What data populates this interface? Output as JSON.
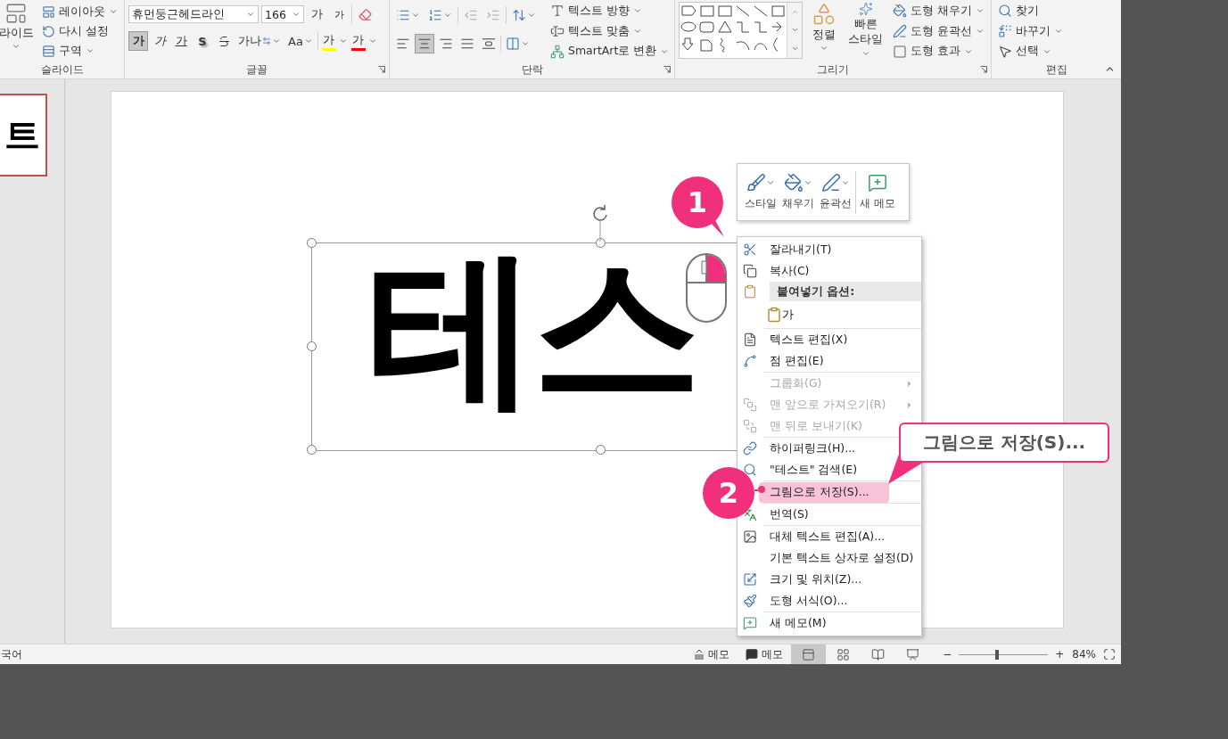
{
  "ribbon": {
    "slides": {
      "big_button": {
        "label": "라이드",
        "dropdown": true
      },
      "buttons": [
        {
          "label": "레이아웃",
          "dropdown": true
        },
        {
          "label": "다시 설정",
          "dropdown": false
        },
        {
          "label": "구역",
          "dropdown": true
        }
      ],
      "label": "슬라이드"
    },
    "font": {
      "font_name": "휴먼둥근헤드라인",
      "font_size": "166",
      "size_buttons": [
        {
          "label": "가"
        },
        {
          "label": "가"
        }
      ],
      "format_buttons": [
        {
          "kind": "bold",
          "label": "가",
          "selected": true
        },
        {
          "kind": "italic",
          "label": "가",
          "selected": false
        },
        {
          "kind": "underline",
          "label": "가",
          "selected": false
        },
        {
          "kind": "shadow",
          "label": "S",
          "selected": false
        },
        {
          "kind": "strike",
          "selected": false
        },
        {
          "kind": "spacing",
          "label": "가나",
          "selected": false
        },
        {
          "kind": "case",
          "label": "Aa",
          "selected": false
        }
      ],
      "color_buttons": [
        {
          "label": "가",
          "color": "#ffff00"
        },
        {
          "label": "가",
          "color": "#ff0000"
        }
      ],
      "label": "글꼴"
    },
    "paragraph": {
      "align_buttons": [
        {
          "selected": false
        },
        {
          "selected": true
        },
        {
          "selected": false
        },
        {
          "selected": false
        },
        {
          "selected": false
        }
      ],
      "text_buttons": [
        {
          "label": "텍스트 방향",
          "dropdown": true
        },
        {
          "label": "텍스트 맞춤",
          "dropdown": true
        },
        {
          "label": "SmartArt로 변환",
          "dropdown": true
        }
      ],
      "label": "단락"
    },
    "drawing": {
      "big_buttons": [
        {
          "label": "정렬",
          "dropdown": true
        },
        {
          "label": "빠른 스타일",
          "dropdown": true
        }
      ],
      "buttons": [
        {
          "label": "도형 채우기",
          "dropdown": true
        },
        {
          "label": "도형 윤곽선",
          "dropdown": true
        },
        {
          "label": "도형 효과",
          "dropdown": true
        }
      ],
      "label": "그리기"
    },
    "editing": {
      "buttons": [
        {
          "label": "찾기",
          "dropdown": false
        },
        {
          "label": "바꾸기",
          "dropdown": true
        },
        {
          "label": "선택",
          "dropdown": true
        }
      ],
      "label": "편집"
    }
  },
  "thumbnail": {
    "text": "트",
    "selected": true
  },
  "slide": {
    "text": "테스"
  },
  "mini_toolbar": {
    "buttons": [
      {
        "label": "스타일",
        "dropdown": true
      },
      {
        "label": "채우기",
        "dropdown": true
      },
      {
        "label": "윤곽선",
        "dropdown": true
      },
      {
        "label": "새 메모",
        "dropdown": false
      }
    ]
  },
  "context_menu": {
    "sections": [
      [
        {
          "kind": "item",
          "label": "잘라내기(T)",
          "disabled": false,
          "selected": false,
          "submenu": false
        },
        {
          "kind": "item",
          "label": "복사(C)",
          "disabled": false,
          "selected": false,
          "submenu": false
        },
        {
          "kind": "header",
          "label": "붙여넣기 옵션:"
        },
        {
          "kind": "paste",
          "label": "가"
        }
      ],
      [
        {
          "kind": "item",
          "label": "텍스트 편집(X)",
          "disabled": false,
          "selected": false,
          "submenu": false
        },
        {
          "kind": "item",
          "label": "점 편집(E)",
          "disabled": false,
          "selected": false,
          "submenu": false
        }
      ],
      [
        {
          "kind": "item",
          "label": "그룹화(G)",
          "disabled": true,
          "selected": false,
          "submenu": true
        },
        {
          "kind": "item",
          "label": "맨 앞으로 가져오기(R)",
          "disabled": true,
          "selected": false,
          "submenu": true
        },
        {
          "kind": "item",
          "label": "맨 뒤로 보내기(K)",
          "disabled": true,
          "selected": false,
          "submenu": false
        }
      ],
      [
        {
          "kind": "item",
          "label": "하이퍼링크(H)...",
          "disabled": false,
          "selected": false,
          "submenu": false
        },
        {
          "kind": "item",
          "label": "\"테스트\" 검색(E)",
          "disabled": false,
          "selected": false,
          "submenu": false
        }
      ],
      [
        {
          "kind": "item",
          "label": "그림으로 저장(S)...",
          "disabled": false,
          "selected": true,
          "submenu": false
        }
      ],
      [
        {
          "kind": "item",
          "label": "번역(S)",
          "disabled": false,
          "selected": false,
          "submenu": false
        }
      ],
      [
        {
          "kind": "item",
          "label": "대체 텍스트 편집(A)...",
          "disabled": false,
          "selected": false,
          "submenu": false
        },
        {
          "kind": "item",
          "label": "기본 텍스트 상자로 설정(D)",
          "disabled": false,
          "selected": false,
          "submenu": false
        },
        {
          "kind": "item",
          "label": "크기 및 위치(Z)...",
          "disabled": false,
          "selected": false,
          "submenu": false
        },
        {
          "kind": "item",
          "label": "도형 서식(O)...",
          "disabled": false,
          "selected": false,
          "submenu": false
        }
      ],
      [
        {
          "kind": "item",
          "label": "새 메모(M)",
          "disabled": false,
          "selected": false,
          "submenu": false
        }
      ]
    ]
  },
  "annotations": {
    "markers": [
      {
        "label": "1"
      },
      {
        "label": "2"
      }
    ],
    "callout": "그림으로 저장(S)..."
  },
  "status_bar": {
    "language": "국어",
    "notes": "메모",
    "comments": "메모",
    "views": [
      {
        "selected": true
      },
      {
        "selected": false
      },
      {
        "selected": false
      },
      {
        "selected": false
      }
    ],
    "zoom": {
      "minus": "−",
      "level": 0.43,
      "plus": "+",
      "value": "84%"
    }
  }
}
